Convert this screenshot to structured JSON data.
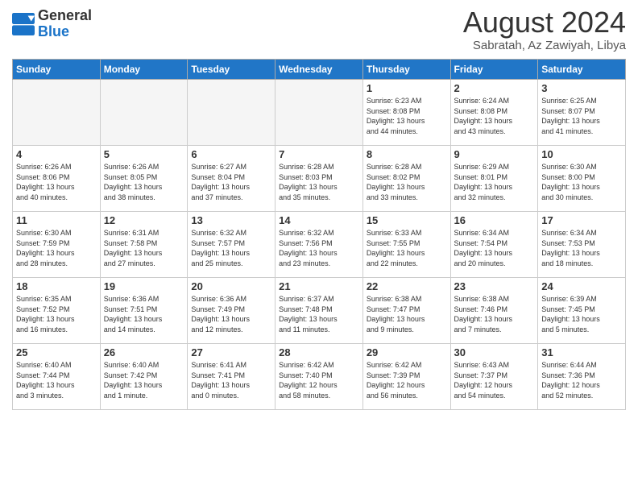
{
  "header": {
    "logo_line1": "General",
    "logo_line2": "Blue",
    "month": "August 2024",
    "location": "Sabratah, Az Zawiyah, Libya"
  },
  "weekdays": [
    "Sunday",
    "Monday",
    "Tuesday",
    "Wednesday",
    "Thursday",
    "Friday",
    "Saturday"
  ],
  "weeks": [
    [
      {
        "day": "",
        "info": ""
      },
      {
        "day": "",
        "info": ""
      },
      {
        "day": "",
        "info": ""
      },
      {
        "day": "",
        "info": ""
      },
      {
        "day": "1",
        "info": "Sunrise: 6:23 AM\nSunset: 8:08 PM\nDaylight: 13 hours\nand 44 minutes."
      },
      {
        "day": "2",
        "info": "Sunrise: 6:24 AM\nSunset: 8:08 PM\nDaylight: 13 hours\nand 43 minutes."
      },
      {
        "day": "3",
        "info": "Sunrise: 6:25 AM\nSunset: 8:07 PM\nDaylight: 13 hours\nand 41 minutes."
      }
    ],
    [
      {
        "day": "4",
        "info": "Sunrise: 6:26 AM\nSunset: 8:06 PM\nDaylight: 13 hours\nand 40 minutes."
      },
      {
        "day": "5",
        "info": "Sunrise: 6:26 AM\nSunset: 8:05 PM\nDaylight: 13 hours\nand 38 minutes."
      },
      {
        "day": "6",
        "info": "Sunrise: 6:27 AM\nSunset: 8:04 PM\nDaylight: 13 hours\nand 37 minutes."
      },
      {
        "day": "7",
        "info": "Sunrise: 6:28 AM\nSunset: 8:03 PM\nDaylight: 13 hours\nand 35 minutes."
      },
      {
        "day": "8",
        "info": "Sunrise: 6:28 AM\nSunset: 8:02 PM\nDaylight: 13 hours\nand 33 minutes."
      },
      {
        "day": "9",
        "info": "Sunrise: 6:29 AM\nSunset: 8:01 PM\nDaylight: 13 hours\nand 32 minutes."
      },
      {
        "day": "10",
        "info": "Sunrise: 6:30 AM\nSunset: 8:00 PM\nDaylight: 13 hours\nand 30 minutes."
      }
    ],
    [
      {
        "day": "11",
        "info": "Sunrise: 6:30 AM\nSunset: 7:59 PM\nDaylight: 13 hours\nand 28 minutes."
      },
      {
        "day": "12",
        "info": "Sunrise: 6:31 AM\nSunset: 7:58 PM\nDaylight: 13 hours\nand 27 minutes."
      },
      {
        "day": "13",
        "info": "Sunrise: 6:32 AM\nSunset: 7:57 PM\nDaylight: 13 hours\nand 25 minutes."
      },
      {
        "day": "14",
        "info": "Sunrise: 6:32 AM\nSunset: 7:56 PM\nDaylight: 13 hours\nand 23 minutes."
      },
      {
        "day": "15",
        "info": "Sunrise: 6:33 AM\nSunset: 7:55 PM\nDaylight: 13 hours\nand 22 minutes."
      },
      {
        "day": "16",
        "info": "Sunrise: 6:34 AM\nSunset: 7:54 PM\nDaylight: 13 hours\nand 20 minutes."
      },
      {
        "day": "17",
        "info": "Sunrise: 6:34 AM\nSunset: 7:53 PM\nDaylight: 13 hours\nand 18 minutes."
      }
    ],
    [
      {
        "day": "18",
        "info": "Sunrise: 6:35 AM\nSunset: 7:52 PM\nDaylight: 13 hours\nand 16 minutes."
      },
      {
        "day": "19",
        "info": "Sunrise: 6:36 AM\nSunset: 7:51 PM\nDaylight: 13 hours\nand 14 minutes."
      },
      {
        "day": "20",
        "info": "Sunrise: 6:36 AM\nSunset: 7:49 PM\nDaylight: 13 hours\nand 12 minutes."
      },
      {
        "day": "21",
        "info": "Sunrise: 6:37 AM\nSunset: 7:48 PM\nDaylight: 13 hours\nand 11 minutes."
      },
      {
        "day": "22",
        "info": "Sunrise: 6:38 AM\nSunset: 7:47 PM\nDaylight: 13 hours\nand 9 minutes."
      },
      {
        "day": "23",
        "info": "Sunrise: 6:38 AM\nSunset: 7:46 PM\nDaylight: 13 hours\nand 7 minutes."
      },
      {
        "day": "24",
        "info": "Sunrise: 6:39 AM\nSunset: 7:45 PM\nDaylight: 13 hours\nand 5 minutes."
      }
    ],
    [
      {
        "day": "25",
        "info": "Sunrise: 6:40 AM\nSunset: 7:44 PM\nDaylight: 13 hours\nand 3 minutes."
      },
      {
        "day": "26",
        "info": "Sunrise: 6:40 AM\nSunset: 7:42 PM\nDaylight: 13 hours\nand 1 minute."
      },
      {
        "day": "27",
        "info": "Sunrise: 6:41 AM\nSunset: 7:41 PM\nDaylight: 13 hours\nand 0 minutes."
      },
      {
        "day": "28",
        "info": "Sunrise: 6:42 AM\nSunset: 7:40 PM\nDaylight: 12 hours\nand 58 minutes."
      },
      {
        "day": "29",
        "info": "Sunrise: 6:42 AM\nSunset: 7:39 PM\nDaylight: 12 hours\nand 56 minutes."
      },
      {
        "day": "30",
        "info": "Sunrise: 6:43 AM\nSunset: 7:37 PM\nDaylight: 12 hours\nand 54 minutes."
      },
      {
        "day": "31",
        "info": "Sunrise: 6:44 AM\nSunset: 7:36 PM\nDaylight: 12 hours\nand 52 minutes."
      }
    ]
  ]
}
